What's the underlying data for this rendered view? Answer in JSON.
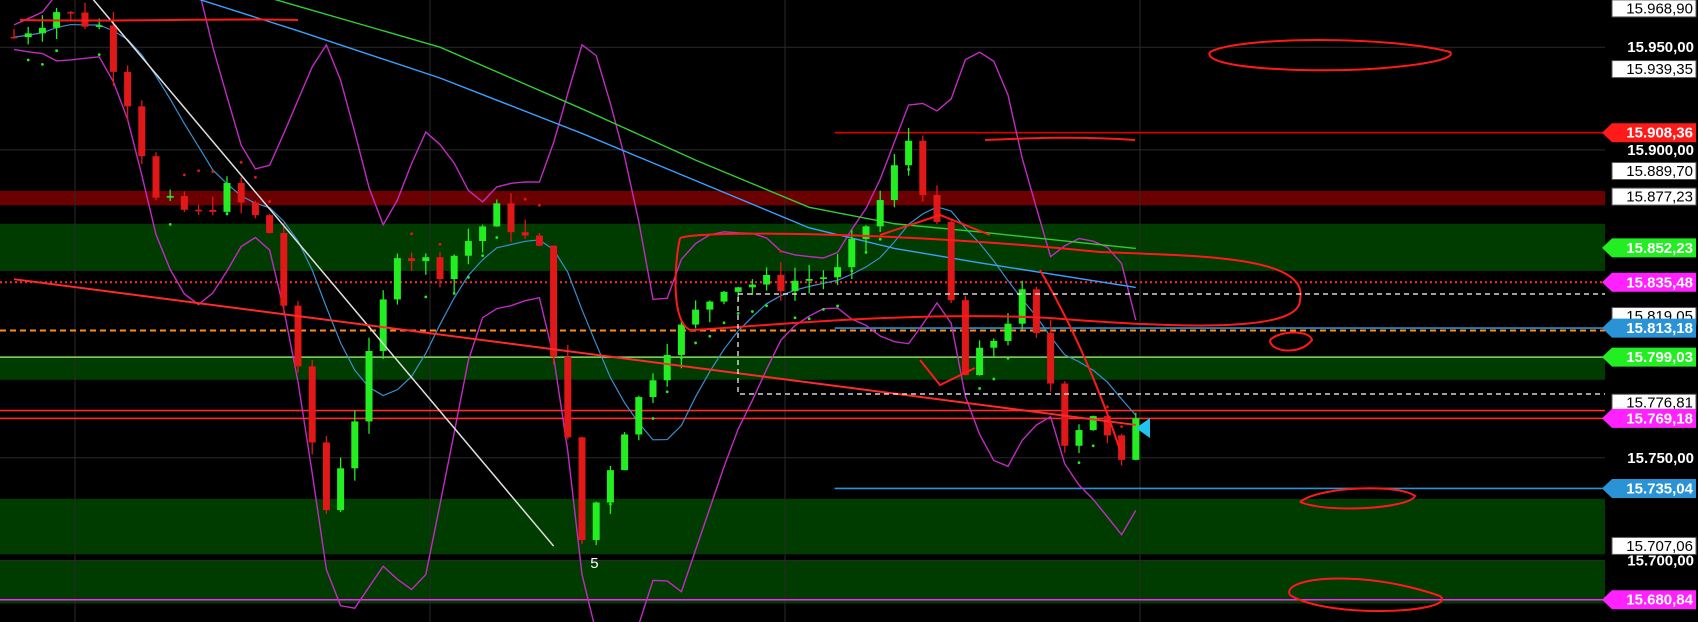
{
  "chart_data": {
    "type": "candlestick",
    "ylim": [
      15670,
      15973
    ],
    "candle_count": 148,
    "grid": true,
    "y_ticks": [
      {
        "value": 15750,
        "text": "15.750,00"
      },
      {
        "value": 15700,
        "text": "15.700,00"
      },
      {
        "value": 15950,
        "text": "15.950,00"
      },
      {
        "value": 15900,
        "text": "15.900,00"
      }
    ],
    "price_labels": [
      {
        "value": 15968.9,
        "text": "15.968,90",
        "style": "white"
      },
      {
        "value": 15939.35,
        "text": "15.939,35",
        "style": "white"
      },
      {
        "value": 15908.36,
        "text": "15.908,36",
        "style": "red",
        "color": "#ff1a1a"
      },
      {
        "value": 15889.7,
        "text": "15.889,70",
        "style": "white"
      },
      {
        "value": 15877.23,
        "text": "15.877,23",
        "style": "white"
      },
      {
        "value": 15852.23,
        "text": "15.852,23",
        "style": "green",
        "color": "#22ee22"
      },
      {
        "value": 15835.48,
        "text": "15.835,48",
        "style": "magenta",
        "color": "#ff22ff"
      },
      {
        "value": 15819.05,
        "text": "15.819,05",
        "style": "white"
      },
      {
        "value": 15813.18,
        "text": "15.813,18",
        "style": "blue",
        "color": "#2a93d6"
      },
      {
        "value": 15799.03,
        "text": "15.799,03",
        "style": "green",
        "color": "#22ee22"
      },
      {
        "value": 15776.81,
        "text": "15.776,81",
        "style": "white"
      },
      {
        "value": 15769.18,
        "text": "15.769,18",
        "style": "magenta",
        "color": "#ff22ff"
      },
      {
        "value": 15735.04,
        "text": "15.735,04",
        "style": "blue",
        "color": "#2a93d6"
      },
      {
        "value": 15707.06,
        "text": "15.707,06",
        "style": "white"
      },
      {
        "value": 15680.84,
        "text": "15.680,84",
        "style": "magenta",
        "color": "#ff22ff"
      }
    ],
    "zones": [
      {
        "from": 15873,
        "to": 15880,
        "color": "#6a0000"
      },
      {
        "from": 15841,
        "to": 15864,
        "color": "#003b00"
      },
      {
        "from": 15788,
        "to": 15799,
        "color": "#003b00"
      },
      {
        "from": 15703,
        "to": 15730,
        "color": "#003b00"
      },
      {
        "from": 15679,
        "to": 15700,
        "color": "#003b00"
      }
    ],
    "levels": [
      {
        "value": 15908.36,
        "color": "#dd0000",
        "from": 0.52,
        "dash": "solid"
      },
      {
        "value": 15813.18,
        "color": "#2a93d6",
        "from": 0.52,
        "dash": "solid"
      },
      {
        "value": 15735.04,
        "color": "#2a93d6",
        "from": 0.52,
        "dash": "solid"
      },
      {
        "value": 15769.18,
        "color": "#ff2a2a",
        "from": 0.0,
        "dash": "solid"
      },
      {
        "value": 15773.0,
        "color": "#ff2a2a",
        "from": 0.0,
        "dash": "solid"
      },
      {
        "value": 15680.84,
        "color": "#ff22ff",
        "from": 0.0,
        "dash": "solid"
      },
      {
        "value": 15812.0,
        "color": "#ff8c1a",
        "from": 0.0,
        "dash": "dashed"
      },
      {
        "value": 15835.48,
        "color": "#ff2a2a",
        "from": 0.0,
        "dash": "dotted"
      },
      {
        "value": 15799.03,
        "color": "#88dd66",
        "from": 0.0,
        "dash": "solid"
      }
    ],
    "annotations": [
      {
        "text": "5",
        "x_index": 37,
        "value": 15705
      }
    ],
    "keypoints": [
      {
        "i": 0,
        "p": 15955
      },
      {
        "i": 3,
        "p": 15968
      },
      {
        "i": 6,
        "p": 15960
      },
      {
        "i": 8,
        "p": 15925
      },
      {
        "i": 10,
        "p": 15875
      },
      {
        "i": 13,
        "p": 15868
      },
      {
        "i": 15,
        "p": 15880
      },
      {
        "i": 18,
        "p": 15860
      },
      {
        "i": 20,
        "p": 15790
      },
      {
        "i": 22,
        "p": 15725
      },
      {
        "i": 24,
        "p": 15770
      },
      {
        "i": 27,
        "p": 15852
      },
      {
        "i": 30,
        "p": 15842
      },
      {
        "i": 34,
        "p": 15870
      },
      {
        "i": 37,
        "p": 15850
      },
      {
        "i": 40,
        "p": 15710
      },
      {
        "i": 43,
        "p": 15765
      },
      {
        "i": 46,
        "p": 15805
      },
      {
        "i": 50,
        "p": 15835
      },
      {
        "i": 54,
        "p": 15835
      },
      {
        "i": 58,
        "p": 15840
      },
      {
        "i": 61,
        "p": 15875
      },
      {
        "i": 63,
        "p": 15905
      },
      {
        "i": 65,
        "p": 15860
      },
      {
        "i": 67,
        "p": 15790
      },
      {
        "i": 69,
        "p": 15808
      },
      {
        "i": 71,
        "p": 15828
      },
      {
        "i": 73,
        "p": 15787
      },
      {
        "i": 74,
        "p": 15760
      },
      {
        "i": 76,
        "p": 15772
      },
      {
        "i": 78,
        "p": 15745
      },
      {
        "i": 79,
        "p": 15772
      }
    ],
    "moving_averages": [
      {
        "color": "#3aa0ff",
        "points": [
          [
            0,
            15996
          ],
          [
            10,
            15980
          ],
          [
            20,
            15958
          ],
          [
            30,
            15935
          ],
          [
            40,
            15908
          ],
          [
            48,
            15885
          ],
          [
            56,
            15862
          ],
          [
            62,
            15852
          ],
          [
            68,
            15845
          ],
          [
            79,
            15833
          ]
        ]
      },
      {
        "color": "#33cc33",
        "points": [
          [
            0,
            16000
          ],
          [
            10,
            15990
          ],
          [
            20,
            15970
          ],
          [
            30,
            15950
          ],
          [
            40,
            15920
          ],
          [
            48,
            15895
          ],
          [
            56,
            15872
          ],
          [
            62,
            15864
          ],
          [
            68,
            15860
          ],
          [
            79,
            15852
          ]
        ]
      }
    ],
    "trendlines": [
      {
        "color": "#e0e0e0",
        "width": 1.5,
        "from": [
          5,
          15978
        ],
        "to": [
          38,
          15707
        ]
      },
      {
        "color": "#ff2a2a",
        "width": 2,
        "from": [
          0,
          15837
        ],
        "to": [
          79,
          15766
        ]
      }
    ]
  }
}
